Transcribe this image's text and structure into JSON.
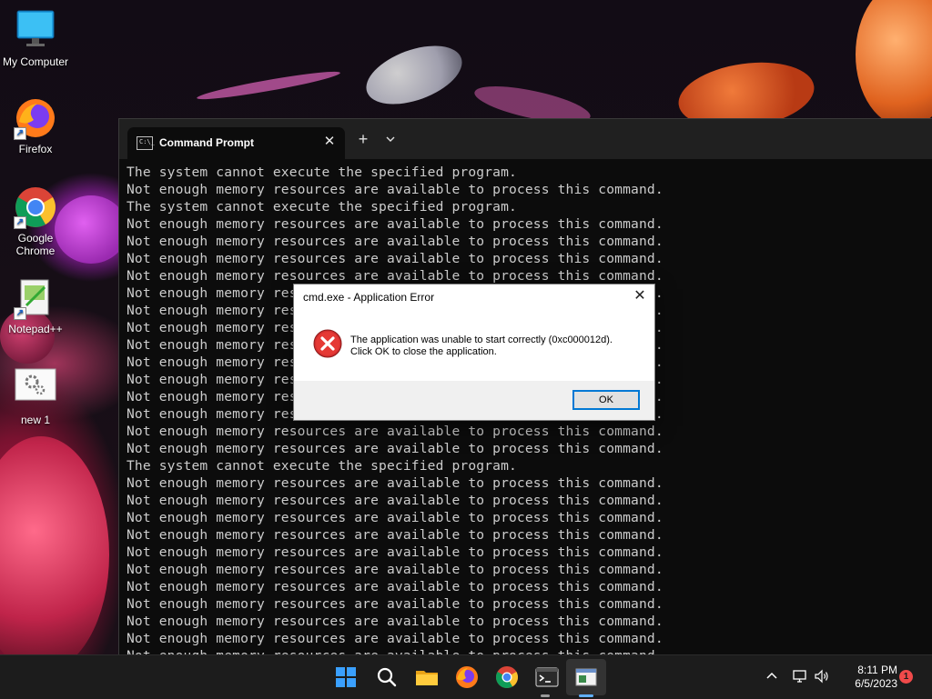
{
  "desktop": {
    "icons": [
      {
        "label": "My Computer"
      },
      {
        "label": "Firefox"
      },
      {
        "label": "Google Chrome"
      },
      {
        "label": "Notepad++"
      },
      {
        "label": "new 1"
      }
    ]
  },
  "terminal": {
    "tab_title": "Command Prompt",
    "lines": [
      "The system cannot execute the specified program.",
      "Not enough memory resources are available to process this command.",
      "The system cannot execute the specified program.",
      "Not enough memory resources are available to process this command.",
      "Not enough memory resources are available to process this command.",
      "Not enough memory resources are available to process this command.",
      "Not enough memory resources are available to process this command.",
      "Not enough memory resources are available to process this command.",
      "Not enough memory resources are available to process this command.",
      "Not enough memory resources are available to process this command.",
      "Not enough memory resources are available to process this command.",
      "Not enough memory resources are available to process this command.",
      "Not enough memory resources are available to process this command.",
      "Not enough memory resources are available to process this command.",
      "Not enough memory resources are available to process this command.",
      "Not enough memory resources are available to process this command.",
      "Not enough memory resources are available to process this command.",
      "The system cannot execute the specified program.",
      "Not enough memory resources are available to process this command.",
      "Not enough memory resources are available to process this command.",
      "Not enough memory resources are available to process this command.",
      "Not enough memory resources are available to process this command.",
      "Not enough memory resources are available to process this command.",
      "Not enough memory resources are available to process this command.",
      "Not enough memory resources are available to process this command.",
      "Not enough memory resources are available to process this command.",
      "Not enough memory resources are available to process this command.",
      "Not enough memory resources are available to process this command.",
      "Not enough memory resources are available to process this command."
    ]
  },
  "dialog": {
    "title": "cmd.exe - Application Error",
    "message_line1": "The application was unable to start correctly (0xc000012d).",
    "message_line2": "Click OK to close the application.",
    "ok_label": "OK"
  },
  "taskbar": {
    "clock_time": "8:11 PM",
    "clock_date": "6/5/2023",
    "notification_count": "1"
  },
  "colors": {
    "console_text": "#cccccc",
    "console_bg": "#0c0c0c",
    "accent": "#0078d4",
    "error_red": "#d32f2f"
  }
}
